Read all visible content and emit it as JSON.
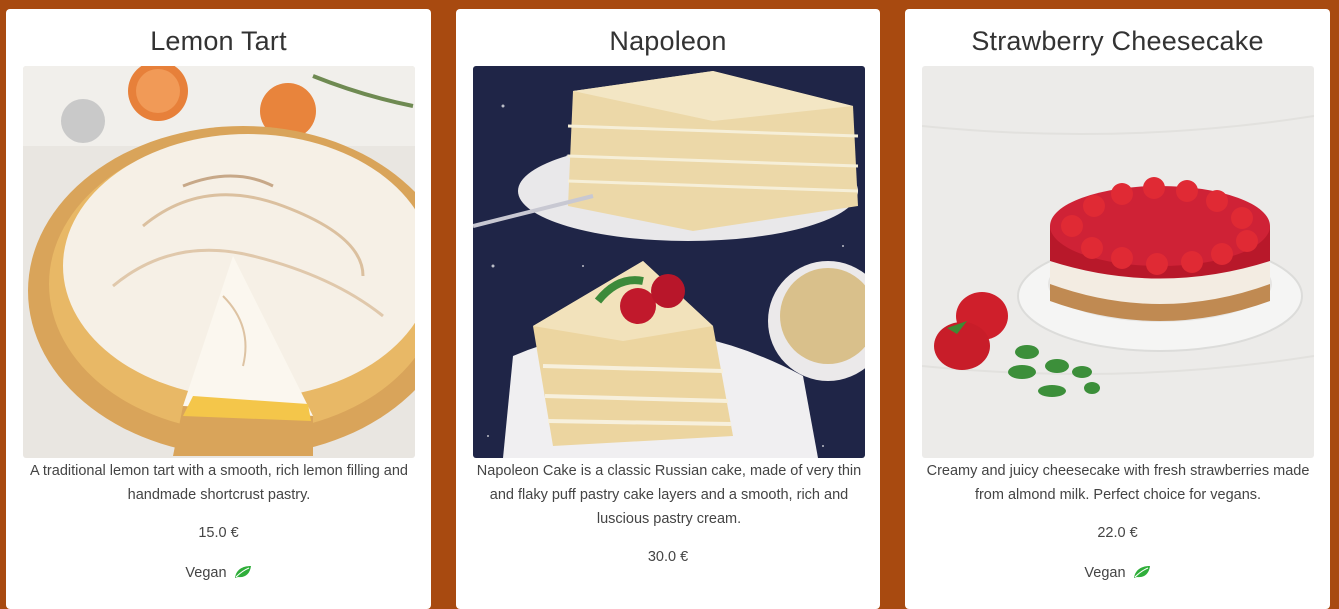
{
  "products": [
    {
      "title": "Lemon Tart",
      "image_alt": "lemon-tart-photo",
      "description": "A traditional lemon tart with a smooth, rich lemon filling and handmade shortcrust pastry.",
      "price": "15.0 €",
      "vegan_label": "Vegan",
      "vegan_icon": "leaf-icon"
    },
    {
      "title": "Napoleon",
      "image_alt": "napoleon-cake-photo",
      "description": "Napoleon Cake is a classic Russian cake, made of very thin and flaky puff pastry cake layers and a smooth, rich and luscious pastry cream.",
      "price": "30.0 €"
    },
    {
      "title": "Strawberry Cheesecake",
      "image_alt": "strawberry-cheesecake-photo",
      "description": "Creamy and juicy cheesecake with fresh strawberries made from almond milk. Perfect choice for vegans.",
      "price": "22.0 €",
      "vegan_label": "Vegan",
      "vegan_icon": "leaf-icon"
    }
  ],
  "colors": {
    "page_background": "#a84a10",
    "card_background": "#ffffff",
    "leaf_green": "#2fae3a"
  }
}
